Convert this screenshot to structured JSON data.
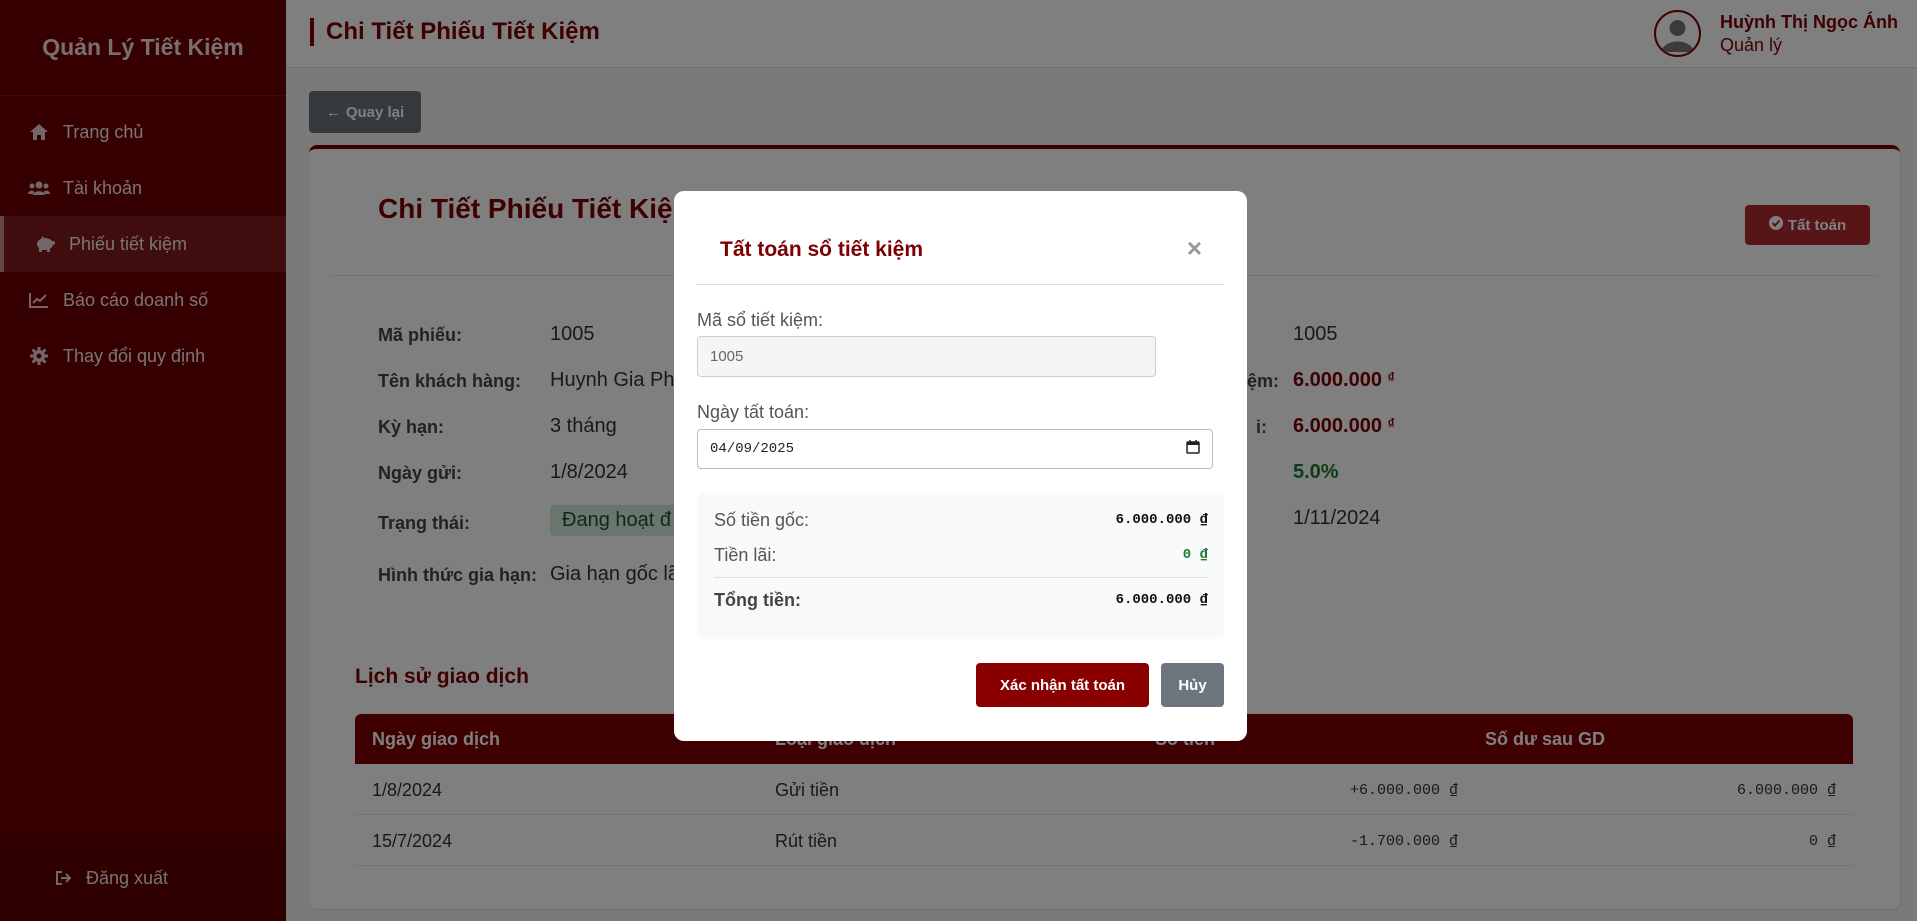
{
  "sidebar": {
    "brand": "Quản Lý Tiết Kiệm",
    "items": [
      {
        "label": "Trang chủ",
        "icon": "home-icon"
      },
      {
        "label": "Tài khoản",
        "icon": "users-icon"
      },
      {
        "label": "Phiếu tiết kiệm",
        "icon": "piggy-bank-icon"
      },
      {
        "label": "Báo cáo doanh số",
        "icon": "chart-line-icon"
      },
      {
        "label": "Thay đổi quy định",
        "icon": "gear-icon"
      }
    ],
    "logout": "Đăng xuất"
  },
  "header": {
    "title": "Chi Tiết Phiếu Tiết Kiệm",
    "user_name": "Huỳnh Thị Ngọc Ánh",
    "user_role": "Quản lý"
  },
  "main": {
    "back_label": "Quay lại",
    "card_title": "Chi Tiết Phiếu Tiết Kiệm",
    "settle_label": "Tất toán",
    "fields_left": [
      {
        "label": "Mã phiếu:",
        "value": "1005"
      },
      {
        "label": "Tên khách hàng:",
        "value": "Huynh Gia Ph"
      },
      {
        "label": "Kỳ hạn:",
        "value": "3 tháng"
      },
      {
        "label": "Ngày gửi:",
        "value": "1/8/2024"
      },
      {
        "label": "Trạng thái:",
        "value": "Đang hoạt đ"
      },
      {
        "label": "Hình thức gia hạn:",
        "value": "Gia hạn gốc lã"
      }
    ],
    "fields_right": [
      {
        "label": "",
        "value": "1005"
      },
      {
        "label": "ệm:",
        "value": "6.000.000"
      },
      {
        "label": "i:",
        "value": "6.000.000"
      },
      {
        "label": "",
        "value": "5.0%"
      },
      {
        "label": "",
        "value": "1/11/2024"
      }
    ],
    "currency_symbol": "₫",
    "history_title": "Lịch sử giao dịch",
    "table": {
      "headers": [
        "Ngày giao dịch",
        "Loại giao dịch",
        "Số tiền",
        "Số dư sau GD"
      ],
      "rows": [
        [
          "1/8/2024",
          "Gửi tiền",
          "+6.000.000 ₫",
          "6.000.000 ₫"
        ],
        [
          "15/7/2024",
          "Rút tiền",
          "-1.700.000 ₫",
          "0 ₫"
        ]
      ]
    }
  },
  "modal": {
    "title": "Tất toán sổ tiết kiệm",
    "close": "×",
    "account_label": "Mã sổ tiết kiệm:",
    "account_value": "1005",
    "date_label": "Ngày tất toán:",
    "date_value": "04/09/2025",
    "principal_label": "Số tiền gốc:",
    "principal_value": "6.000.000 ₫",
    "interest_label": "Tiền lãi:",
    "interest_value": "0 ₫",
    "total_label": "Tổng tiền:",
    "total_value": "6.000.000 ₫",
    "confirm_label": "Xác nhận tất toán",
    "cancel_label": "Hủy"
  },
  "colors": {
    "brand": "#7d0000",
    "sidebar": "#6d0000",
    "success": "#1e7b34",
    "secondary": "#6c757d"
  }
}
